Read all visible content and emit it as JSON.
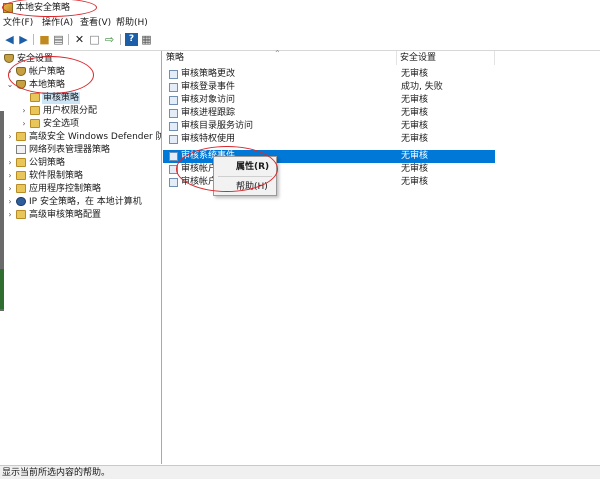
{
  "window": {
    "title": "本地安全策略"
  },
  "menu": {
    "file": "文件(F)",
    "action": "操作(A)",
    "view": "查看(V)",
    "help": "帮助(H)"
  },
  "toolbar": {
    "back": "back-arrow-icon",
    "forward": "forward-arrow-icon",
    "up": "up-folder-icon",
    "show_hide": "console-tree-icon",
    "delete": "delete-x-icon",
    "properties": "properties-icon",
    "export": "export-list-icon",
    "help": "help-icon",
    "show_pane": "action-pane-icon"
  },
  "tree": [
    {
      "label": "安全设置",
      "icon": "security-settings-icon"
    },
    {
      "label": "帐户策略",
      "icon": "shield-folder-icon"
    },
    {
      "label": "本地策略",
      "icon": "shield-folder-icon"
    },
    {
      "label": "审核策略",
      "icon": "folder-icon"
    },
    {
      "label": "用户权限分配",
      "icon": "folder-icon"
    },
    {
      "label": "安全选项",
      "icon": "folder-icon"
    },
    {
      "label": "高级安全 Windows Defender 防火墙",
      "icon": "firewall-folder-icon"
    },
    {
      "label": "网络列表管理器策略",
      "icon": "network-list-icon"
    },
    {
      "label": "公钥策略",
      "icon": "folder-icon"
    },
    {
      "label": "软件限制策略",
      "icon": "folder-icon"
    },
    {
      "label": "应用程序控制策略",
      "icon": "folder-icon"
    },
    {
      "label": "IP 安全策略，在 本地计算机",
      "icon": "ip-security-icon"
    },
    {
      "label": "高级审核策略配置",
      "icon": "folder-icon"
    }
  ],
  "list": {
    "columns": {
      "policy": "策略",
      "setting": "安全设置"
    },
    "rows": [
      {
        "name": "审核策略更改",
        "value": "无审核"
      },
      {
        "name": "审核登录事件",
        "value": "成功, 失败"
      },
      {
        "name": "审核对象访问",
        "value": "无审核"
      },
      {
        "name": "审核进程跟踪",
        "value": "无审核"
      },
      {
        "name": "审核目录服务访问",
        "value": "无审核"
      },
      {
        "name": "审核特权使用",
        "value": "无审核"
      },
      {
        "name": "审核系统事件",
        "value": "无审核"
      },
      {
        "name": "审核帐户管",
        "value": "无审核"
      },
      {
        "name": "审核帐户登",
        "value": "无审核"
      }
    ]
  },
  "context_menu": {
    "properties": "属性(R)",
    "help": "帮助(H)"
  },
  "status": {
    "text": "显示当前所选内容的帮助。"
  },
  "colors": {
    "selection": "#0078d7",
    "annotation": "#d8282c",
    "folder": "#e9c65a"
  }
}
